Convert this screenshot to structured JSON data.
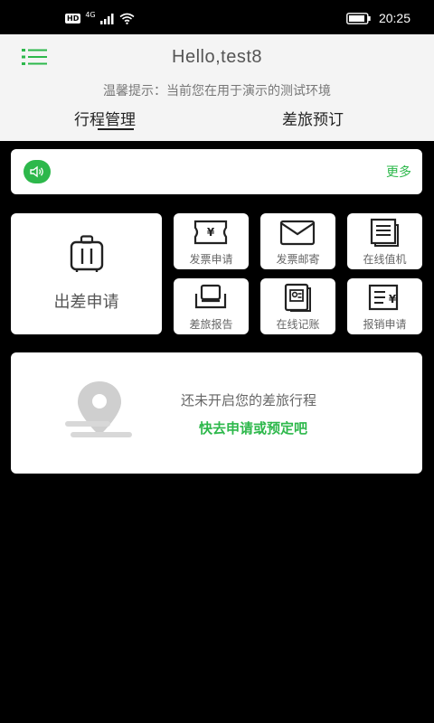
{
  "status_bar": {
    "hd": "HD",
    "network": "4G",
    "time": "20:25"
  },
  "header": {
    "greeting": "Hello,test8",
    "notice": "温馨提示：当前您在用于演示的测试环境",
    "tabs": [
      {
        "label": "行程管理",
        "active": true
      },
      {
        "label": "差旅预订",
        "active": false
      }
    ]
  },
  "announcement": {
    "more_label": "更多"
  },
  "quick_actions": {
    "apply_label": "出差申请",
    "items": [
      {
        "label": "发票申请",
        "icon": "invoice-yuan-icon"
      },
      {
        "label": "发票邮寄",
        "icon": "envelope-icon"
      },
      {
        "label": "在线值机",
        "icon": "document-icon"
      },
      {
        "label": "差旅报告",
        "icon": "seat-icon"
      },
      {
        "label": "在线记账",
        "icon": "id-card-icon"
      },
      {
        "label": "报销申请",
        "icon": "reimbursement-icon"
      }
    ]
  },
  "trip_empty": {
    "message": "还未开启您的差旅行程",
    "cta": "快去申请或预定吧"
  },
  "colors": {
    "accent": "#2db84b",
    "header_bg": "#f4f4f4",
    "page_bg": "#000000"
  }
}
